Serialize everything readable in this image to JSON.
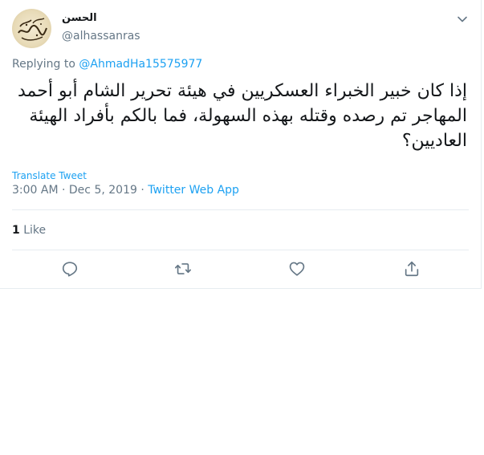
{
  "tweet": {
    "display_name": "الحسن",
    "handle": "@alhassanras",
    "replying_prefix": "Replying to",
    "replying_to": "@AhmadHa15575977",
    "text": "إذا كان خبير الخبراء العسكريين في هيئة تحرير الشام أبو أحمد المهاجر تم رصده وقتله بهذه السهولة، فما بالكم بأفراد الهيئة العاديين؟",
    "translate_label": "Translate Tweet",
    "time": "3:00 AM",
    "separator": "·",
    "date": "Dec 5, 2019",
    "source": "Twitter Web App",
    "like_count": "1",
    "like_label": "Like"
  },
  "icons": {
    "caret": "chevron-down-icon",
    "reply": "reply-icon",
    "retweet": "retweet-icon",
    "like": "heart-icon",
    "share": "share-icon"
  },
  "colors": {
    "accent": "#1da1f2",
    "secondary_text": "#657786",
    "primary_text": "#14171a",
    "border": "#e6ecf0"
  }
}
